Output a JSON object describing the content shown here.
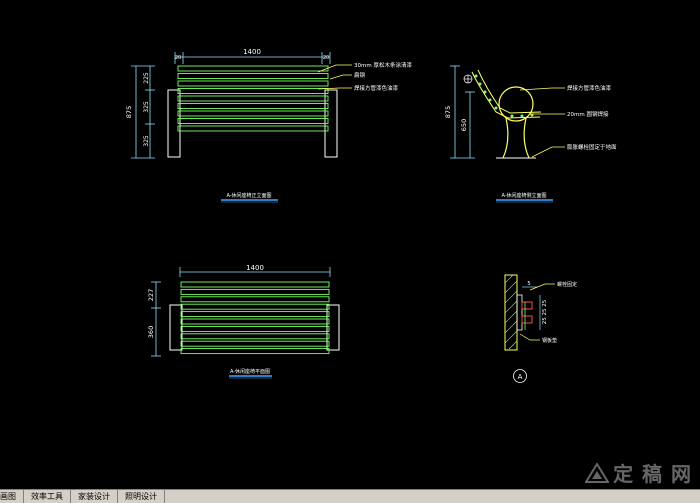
{
  "colors": {
    "background": "#000000",
    "slat": "#7dff6a",
    "frame": "#ffffff",
    "dimension": "#8fe0ff",
    "leader": "#ffff66",
    "caption_line": "#4aa3ff",
    "tabbar": "#d4d0c8"
  },
  "front_elevation": {
    "width_dim": "1400",
    "left_offset": "20",
    "right_offset": "20",
    "height_total": "875",
    "heights": [
      "225",
      "325",
      "325"
    ],
    "labels": [
      "30mm 厚松木条涂清漆",
      "扁钢",
      "焊接方管漆色油漆"
    ],
    "caption": "A-休闲座椅正立面图"
  },
  "side_elevation": {
    "height_total": "875",
    "height_sub": "650",
    "labels": [
      "焊接方管漆色油漆",
      "20mm 圆钢焊接",
      "膨胀螺栓固定于地面"
    ],
    "caption": "A-休闲座椅侧立面图"
  },
  "plan_view": {
    "width_dim": "1400",
    "depths": [
      "227",
      "360"
    ],
    "caption": "A-休闲座椅平面图"
  },
  "detail": {
    "dim_top": "5",
    "dims_right": "25 25 25",
    "labels": [
      "螺栓固定",
      "钢板垫"
    ],
    "marker": "A"
  },
  "tabs": [
    "画图",
    "效率工具",
    "家装设计",
    "照明设计"
  ],
  "watermark": {
    "text": "定 稿 网",
    "icon": "logo-icon"
  }
}
